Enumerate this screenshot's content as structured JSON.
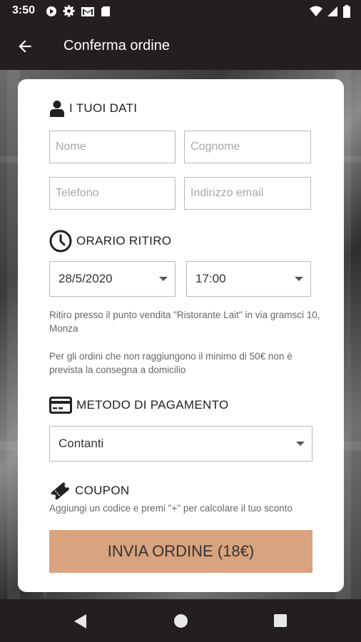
{
  "status_bar": {
    "time": "3:50",
    "left_icons": [
      "play-store-icon",
      "settings-gear-icon",
      "gmail-icon",
      "sd-card-icon"
    ],
    "right_icons": [
      "wifi-icon",
      "signal-icon",
      "battery-icon"
    ]
  },
  "app_bar": {
    "title": "Conferma ordine",
    "back_icon": "arrow-back-icon"
  },
  "personal": {
    "title": "I TUOI DATI",
    "icon": "person-icon",
    "name_placeholder": "Nome",
    "surname_placeholder": "Cognome",
    "phone_placeholder": "Telefono",
    "email_placeholder": "Indirizzo email"
  },
  "pickup": {
    "title": "ORARIO RITIRO",
    "icon": "clock-icon",
    "date": "28/5/2020",
    "time": "17:00",
    "note1": "Ritiro presso il punto vendita \"Ristorante Lait\" in via gramsci 10, Monza",
    "note2": "Per gli ordini che non raggiungono il minimo di 50€ non è prevista la consegna a domicilio"
  },
  "payment": {
    "title": "METODO DI PAGAMENTO",
    "icon": "credit-card-icon",
    "selected": "Contanti"
  },
  "coupon": {
    "title": "COUPON",
    "icon": "ticket-icon",
    "hint": "Aggiungi un codice e premi \"+\" per calcolare il tuo sconto"
  },
  "submit": {
    "label": "INVIA ORDINE (18€)",
    "color": "#d8a37e"
  },
  "nav_bar": {
    "icons": [
      "nav-back-icon",
      "nav-home-icon",
      "nav-recents-icon"
    ]
  },
  "colors": {
    "bar_background": "#231f1f",
    "card_background": "#ffffff"
  }
}
